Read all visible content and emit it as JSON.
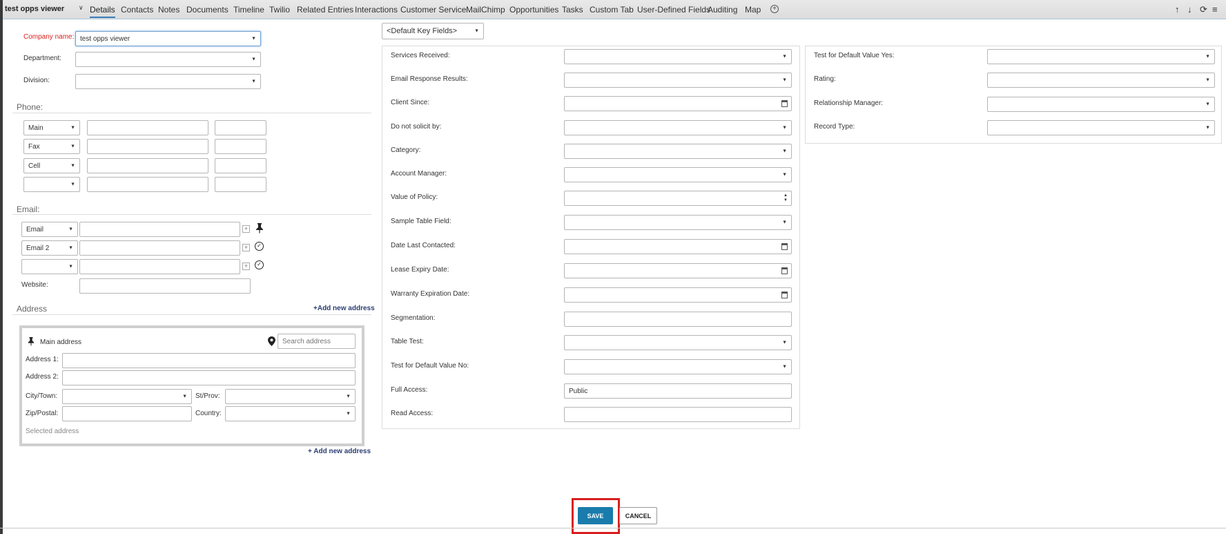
{
  "header": {
    "title": "test opps viewer",
    "tabs": [
      "Details",
      "Contacts",
      "Notes",
      "Documents",
      "Timeline",
      "Twilio",
      "Related Entries",
      "Interactions",
      "Customer Service",
      "MailChimp",
      "Opportunities",
      "Tasks",
      "Custom Tab",
      "User-Defined Fields",
      "Auditing",
      "Map"
    ],
    "active_tab": "Details",
    "icons": [
      "chevron-down-icon",
      "add-tab-icon",
      "arrow-up-icon",
      "arrow-down-icon",
      "refresh-icon",
      "menu-icon"
    ]
  },
  "company": {
    "company_name_label": "Company name:",
    "company_name_value": "test opps viewer",
    "department_label": "Department:",
    "division_label": "Division:"
  },
  "phone": {
    "section_label": "Phone:",
    "rows": [
      {
        "type": "Main"
      },
      {
        "type": "Fax"
      },
      {
        "type": "Cell"
      },
      {
        "type": ""
      }
    ]
  },
  "email": {
    "section_label": "Email:",
    "rows": [
      {
        "type": "Email"
      },
      {
        "type": "Email 2"
      },
      {
        "type": ""
      }
    ],
    "website_label": "Website:"
  },
  "address": {
    "section_label": "Address",
    "add_link": "Add new address",
    "add_link_bottom": "Add new address",
    "main_address_label": "Main address",
    "search_placeholder": "Search address",
    "address1_label": "Address 1:",
    "address2_label": "Address 2:",
    "city_label": "City/Town:",
    "state_label": "St/Prov:",
    "zip_label": "Zip/Postal:",
    "country_label": "Country:",
    "selected_label": "Selected address"
  },
  "key_fields": {
    "selector": "<Default Key Fields>",
    "fields": [
      {
        "label": "Services Received:",
        "value": "",
        "kind": "dropdown"
      },
      {
        "label": "Email Response Results:",
        "value": "",
        "kind": "dropdown"
      },
      {
        "label": "Client Since:",
        "value": "",
        "kind": "date"
      },
      {
        "label": "Do not solicit by:",
        "value": "",
        "kind": "dropdown"
      },
      {
        "label": "Category:",
        "value": "",
        "kind": "dropdown"
      },
      {
        "label": "Account Manager:",
        "value": "",
        "kind": "dropdown"
      },
      {
        "label": "Value of Policy:",
        "value": "",
        "kind": "number"
      },
      {
        "label": "Sample Table Field:",
        "value": "",
        "kind": "dropdown"
      },
      {
        "label": "Date Last Contacted:",
        "value": "",
        "kind": "date"
      },
      {
        "label": "Lease Expiry Date:",
        "value": "",
        "kind": "date"
      },
      {
        "label": "Warranty Expiration Date:",
        "value": "",
        "kind": "date"
      },
      {
        "label": "Segmentation:",
        "value": "",
        "kind": "text"
      },
      {
        "label": "Table Test:",
        "value": "",
        "kind": "dropdown"
      },
      {
        "label": "Test for Default Value No:",
        "value": "",
        "kind": "dropdown"
      },
      {
        "label": "Full Access:",
        "value": "Public",
        "kind": "text"
      },
      {
        "label": "Read Access:",
        "value": "",
        "kind": "text"
      }
    ]
  },
  "right_fields": [
    {
      "label": "Test for Default Value Yes:",
      "value": ""
    },
    {
      "label": "Rating:",
      "value": ""
    },
    {
      "label": "Relationship Manager:",
      "value": ""
    },
    {
      "label": "Record Type:",
      "value": ""
    }
  ],
  "actions": {
    "save_label": "SAVE",
    "cancel_label": "CANCEL",
    "highlight_color": "#d81e1e",
    "save_color": "#1a7cac"
  }
}
